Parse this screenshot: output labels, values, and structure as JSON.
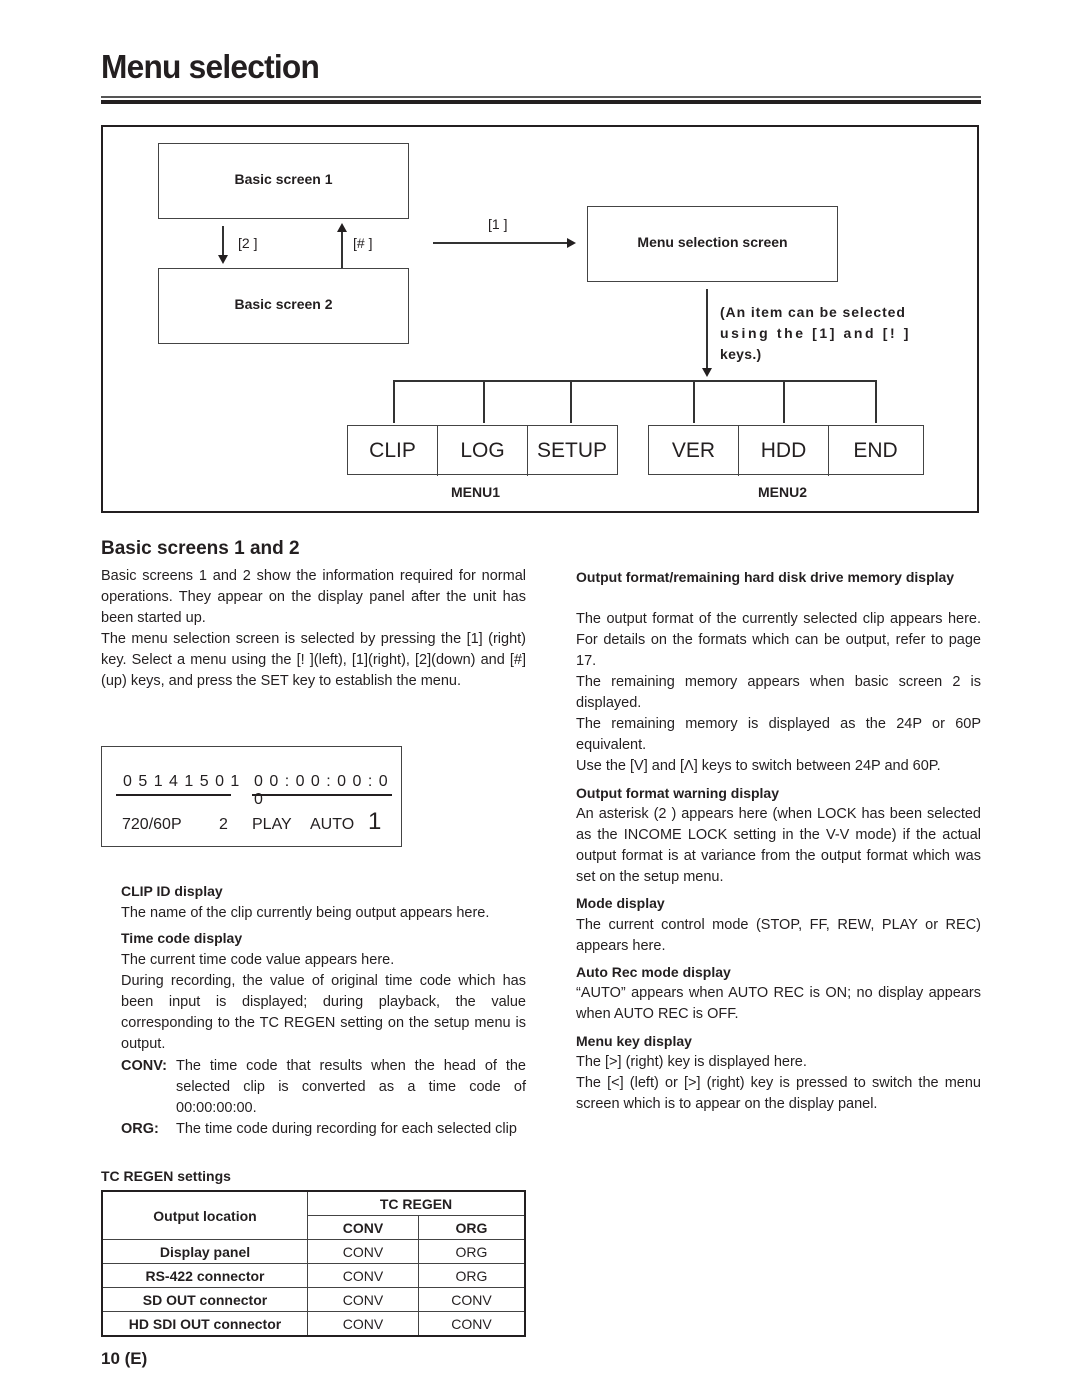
{
  "page": {
    "title": "Menu selection",
    "footer": "10 (E)"
  },
  "diagram": {
    "basic_screen_1": "Basic screen 1",
    "basic_screen_2": "Basic screen 2",
    "key_down": "[2 ]",
    "key_up": "[# ]",
    "key_right": "[1 ]",
    "menu_selection_screen": "Menu selection screen",
    "note_line1": "(An item can be selected",
    "note_line2": "using the [1] and [! ]",
    "note_line3": "keys.)",
    "menu1": {
      "caption": "MENU1",
      "items": [
        "CLIP",
        "LOG",
        "SETUP"
      ]
    },
    "menu2": {
      "caption": "MENU2",
      "items": [
        "VER",
        "HDD",
        "END"
      ]
    }
  },
  "basic_screens": {
    "heading": "Basic screens 1 and 2",
    "para1": "Basic screens 1 and 2 show the information required for normal operations.  They appear on the display panel after the unit has been started up.",
    "para2": "The menu selection screen is selected by pressing the [1] (right) key.  Select a menu using the [! ](left), [1](right), [2](down) and [#](up) keys, and press the SET key to establish the menu."
  },
  "lcd": {
    "clip_id": "0 5 1 4 1 5 0 1",
    "timecode": "0 0 : 0 0 : 0 0 : 0 0",
    "format": "720/60P",
    "warning": "2",
    "mode": "PLAY",
    "auto": "AUTO",
    "menu_key": "1"
  },
  "left_sections": {
    "clip_id_heading": "CLIP ID display",
    "clip_id_text": "The name of the clip currently being output appears here.",
    "timecode_heading": "Time code display",
    "timecode_text1": "The current time code value appears here.",
    "timecode_text2": "During recording, the value of original time code which has been input is displayed; during playback, the value corresponding to the TC REGEN setting on the setup menu is output.",
    "conv_label": "CONV:",
    "conv_text": "The time code that results when the head of the selected clip is converted as a time code of 00:00:00:00.",
    "org_label": "ORG:",
    "org_text": "The time code during recording for each selected clip",
    "tc_regen_heading": "TC REGEN settings"
  },
  "tc_table": {
    "col_output_location": "Output location",
    "col_tc_regen": "TC REGEN",
    "col_conv": "CONV",
    "col_org": "ORG",
    "rows": [
      {
        "location": "Display panel",
        "conv": "CONV",
        "org": "ORG"
      },
      {
        "location": "RS-422 connector",
        "conv": "CONV",
        "org": "ORG"
      },
      {
        "location": "SD OUT connector",
        "conv": "CONV",
        "org": "CONV"
      },
      {
        "location": "HD SDI OUT connector",
        "conv": "CONV",
        "org": "CONV"
      }
    ]
  },
  "right_sections": {
    "output_format_heading": "Output format/remaining hard disk drive memory display",
    "output_format_text1": "The output format of the currently selected clip appears here.  For details on the formats which can be output, refer to page 17.",
    "output_format_text2": "The remaining memory appears when basic screen 2 is displayed.",
    "output_format_text3": "The remaining memory is displayed as the 24P or 60P equivalent.",
    "output_format_text4": "Use the [V] and [Λ] keys to switch between 24P and 60P.",
    "warning_heading": "Output format warning display",
    "warning_text": "An asterisk (2 ) appears here (when LOCK has been selected as the INCOME LOCK setting in the V-V mode) if the actual output format is at variance from the output format which was set on the setup menu.",
    "mode_heading": "Mode display",
    "mode_text": "The current control mode (STOP, FF, REW, PLAY or REC) appears here.",
    "autorec_heading": "Auto Rec mode display",
    "autorec_text": "“AUTO” appears when AUTO REC is ON; no display appears when AUTO REC is OFF.",
    "menukey_heading": "Menu key display",
    "menukey_text1": "The [>] (right) key is displayed here.",
    "menukey_text2": "The [<] (left) or [>] (right) key is pressed to switch the menu screen which is to appear on the display panel."
  }
}
